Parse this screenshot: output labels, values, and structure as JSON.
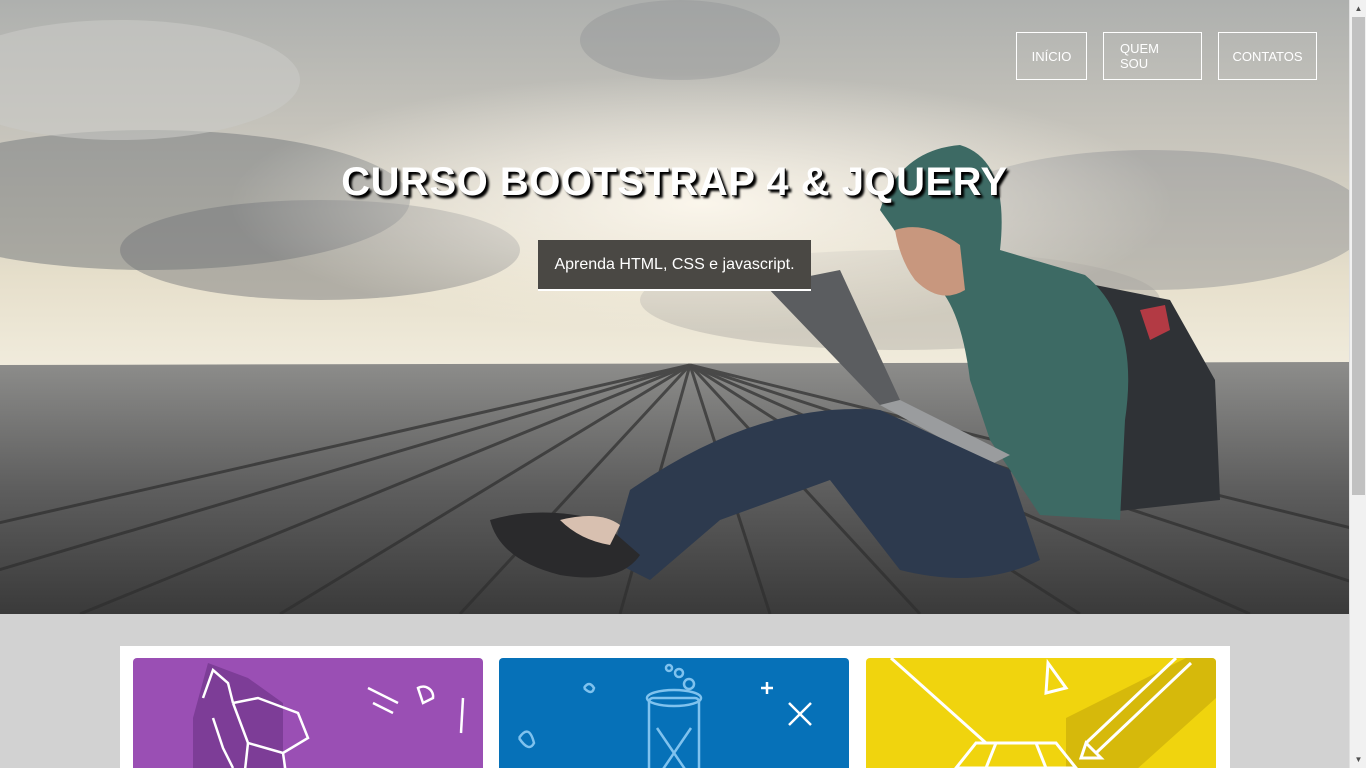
{
  "nav": {
    "items": [
      {
        "label": "INÍCIO"
      },
      {
        "label": "QUEM SOU"
      },
      {
        "label": "CONTATOS"
      }
    ]
  },
  "hero": {
    "title": "CURSO BOOTSTRAP 4 & JQUERY",
    "subtitle": "Aprenda HTML, CSS e javascript."
  },
  "cards": [
    {
      "color": "#9a4fb4",
      "icon": "origami-elephant-icon"
    },
    {
      "color": "#0671b8",
      "icon": "test-tube-icon"
    },
    {
      "color": "#f0d40e",
      "icon": "gem-pencil-icon"
    }
  ],
  "scrollbar": {
    "up_icon": "scroll-up-arrow",
    "down_icon": "scroll-down-arrow"
  }
}
